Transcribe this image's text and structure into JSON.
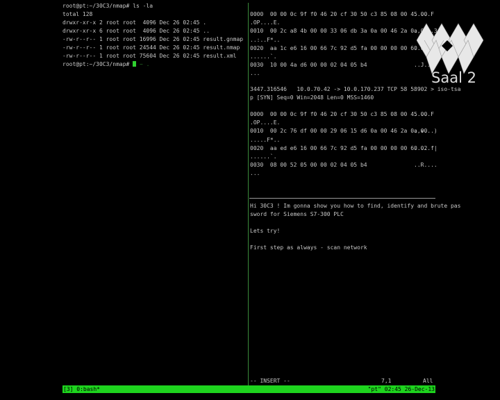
{
  "left_terminal": {
    "lines": [
      "root@pt:~/30C3/nmap# ls -la",
      "total 128",
      "drwxr-xr-x 2 root root  4096 Dec 26 02:45 .",
      "drwxr-xr-x 6 root root  4096 Dec 26 02:45 ..",
      "-rw-r--r-- 1 root root 16996 Dec 26 02:45 result.gnmap",
      "-rw-r--r-- 1 root root 24544 Dec 26 02:45 result.nmap",
      "-rw-r--r-- 1 root root 75604 Dec 26 02:45 result.xml"
    ],
    "prompt": "root@pt:~/30C3/nmap# ",
    "ghost_text": "~ ."
  },
  "packet_dump": {
    "packet1": [
      {
        "hex": "0000  00 00 0c 9f f0 46 20 cf 30 50 c3 85 08 00 45 00",
        "ascii": ".....F"
      },
      {
        "hex": ".OP....E.",
        "ascii": ""
      },
      {
        "hex": "0010  00 2c a8 4b 00 00 33 06 db 3a 0a 00 46 2a 0a 00",
        "ascii": ".,.K..3"
      },
      {
        "hex": "..:..F*..",
        "ascii": ""
      },
      {
        "hex": "0020  aa 1c e6 16 00 66 7c 92 d5 fa 00 00 00 00 60 02",
        "ascii": ".....f|"
      },
      {
        "hex": "......`.",
        "ascii": ""
      },
      {
        "hex": "0030  10 00 4a d6 00 00 02 04 05 b4",
        "ascii": "..J...."
      },
      {
        "hex": "...",
        "ascii": ""
      }
    ],
    "summary_1": "3447.316546   10.0.70.42 -> 10.0.170.237 TCP 58 58902 > iso-tsa",
    "summary_2": "p [SYN] Seq=0 Win=2048 Len=0 MSS=1460",
    "packet2": [
      {
        "hex": "0000  00 00 0c 9f f0 46 20 cf 30 50 c3 85 08 00 45 00",
        "ascii": ".....F"
      },
      {
        "hex": ".OP....E.",
        "ascii": ""
      },
      {
        "hex": "0010  00 2c 76 df 00 00 29 06 15 d6 0a 00 46 2a 0a 00",
        "ascii": ".,v...)"
      },
      {
        "hex": ".....F*..",
        "ascii": ""
      },
      {
        "hex": "0020  aa ed e6 16 00 66 7c 92 d5 fa 00 00 00 00 60 02",
        "ascii": ".....f|"
      },
      {
        "hex": "......`.",
        "ascii": ""
      },
      {
        "hex": "0030  08 00 52 05 00 00 02 04 05 b4",
        "ascii": "..R...."
      },
      {
        "hex": "...",
        "ascii": ""
      }
    ]
  },
  "vim_pane": {
    "lines": [
      "Hi 30C3 ! Im gonna show you how to find, identify and brute pas",
      "sword for Siemens S7-300 PLC",
      "",
      "Lets try!",
      "",
      "First step as always - scan network"
    ],
    "mode": "-- INSERT --",
    "position": "7,1",
    "scroll": "All"
  },
  "tmux_status": {
    "left": "[3] 0:bash*",
    "right": "\"pt\" 02:45 26-Dec-13"
  },
  "logo": {
    "text": "Saal 2"
  }
}
